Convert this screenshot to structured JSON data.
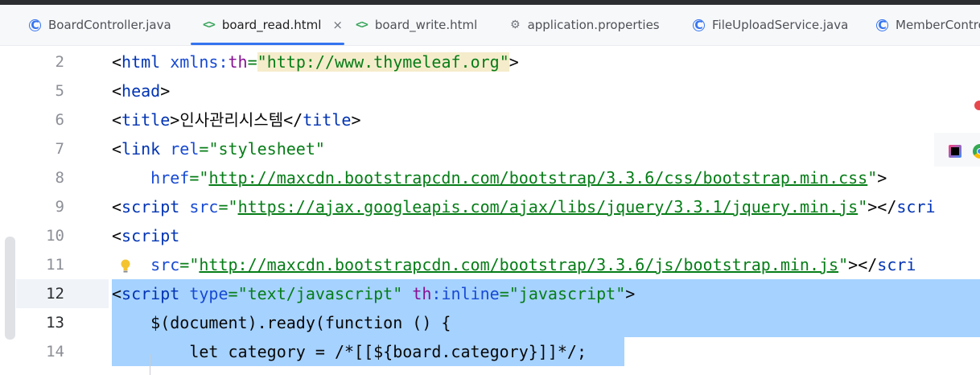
{
  "tabs": [
    {
      "label": "BoardController.java",
      "icon": "java-class-icon",
      "active": false
    },
    {
      "label": "board_read.html",
      "icon": "html-icon",
      "active": true,
      "close": "×"
    },
    {
      "label": "board_write.html",
      "icon": "html-icon",
      "active": false
    },
    {
      "label": "application.properties",
      "icon": "gear-icon",
      "active": false
    },
    {
      "label": "FileUploadService.java",
      "icon": "java-class-icon",
      "active": false
    },
    {
      "label": "MemberContro",
      "icon": "java-class-icon",
      "active": false
    }
  ],
  "editor": {
    "lines": [
      {
        "number": "2"
      },
      {
        "number": "5"
      },
      {
        "number": "6"
      },
      {
        "number": "7"
      },
      {
        "number": "8"
      },
      {
        "number": "9"
      },
      {
        "number": "10"
      },
      {
        "number": "11"
      },
      {
        "number": "12",
        "selected": true
      },
      {
        "number": "13",
        "selected": true
      },
      {
        "number": "14",
        "selected": true
      }
    ],
    "code": {
      "l2": {
        "lt": "<",
        "tag": "html",
        "sp": " ",
        "attr": "xmlns:",
        "ns": "th",
        "eq": "=",
        "q1": "\"",
        "url": "http://www.thymeleaf.org",
        "q2": "\"",
        "gt": ">"
      },
      "l5": {
        "open": "<",
        "tag": "head",
        "close": ">"
      },
      "l6": {
        "open": "<",
        "tag": "title",
        "close1": ">",
        "text": "인사관리시스템",
        "open2": "</",
        "tag2": "title",
        "close2": ">"
      },
      "l7": {
        "open": "<",
        "tag": "link",
        "sp": " ",
        "attr": "rel",
        "eq": "=",
        "val": "\"stylesheet\""
      },
      "l8": {
        "indent": "    ",
        "attr": "href",
        "eq": "=",
        "q1": "\"",
        "url": "http://maxcdn.bootstrapcdn.com/bootstrap/3.3.6/css/bootstrap.min.css",
        "q2": "\"",
        "gt": ">"
      },
      "l9": {
        "open": "<",
        "tag": "script",
        "sp": " ",
        "attr": "src",
        "eq": "=",
        "q1": "\"",
        "url": "https://ajax.googleapis.com/ajax/libs/jquery/3.3.1/jquery.min.js",
        "q2": "\"",
        "close": "></",
        "tag2": "scri"
      },
      "l10": {
        "open": "<",
        "tag": "script"
      },
      "l11": {
        "indent": "    ",
        "attr": "src",
        "eq": "=",
        "q1": "\"",
        "url": "http://maxcdn.bootstrapcdn.com/bootstrap/3.3.6/js/bootstrap.min.js",
        "q2": "\"",
        "close": "></",
        "tag2": "scri"
      },
      "l12": {
        "open": "<",
        "tag": "script",
        "sp": " ",
        "attr": "type",
        "eq": "=",
        "val": "\"text/javascript\"",
        "sp2": " ",
        "ns": "th",
        "attr2": ":inline",
        "eq2": "=",
        "val2": "\"javascript\"",
        "close": ">"
      },
      "l13": {
        "text": "    $(document).ready(function () {"
      },
      "l14": {
        "text": "        let category = /*[[${board.category}]]*/;"
      }
    }
  },
  "colors": {
    "tag": "#0033b3",
    "attribute": "#174ad4",
    "namespace": "#871094",
    "string": "#067d17",
    "selection": "#a6d2ff",
    "active_tab_underline": "#3574f0"
  }
}
